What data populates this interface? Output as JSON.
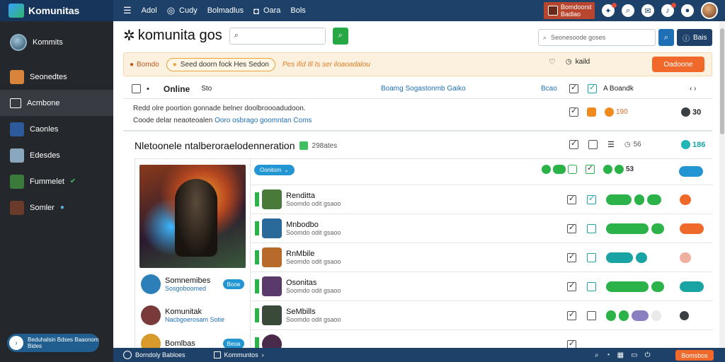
{
  "topbar": {
    "brand": "Komunitas",
    "nav": [
      {
        "icon": "menu-icon",
        "label": ""
      },
      {
        "icon": "",
        "label": "Adol"
      },
      {
        "icon": "globe-icon",
        "label": "Cudy"
      },
      {
        "icon": "",
        "label": "Bolmadlus"
      },
      {
        "icon": "shield-icon",
        "label": "Oara"
      },
      {
        "icon": "",
        "label": "Bols"
      }
    ],
    "promo": "Bomdoorst Badlao",
    "icons": [
      "gamepad-icon",
      "search-icon",
      "mail-icon",
      "bell-icon",
      "chat-icon"
    ]
  },
  "sidebar": {
    "items": [
      {
        "label": "Kommits",
        "kind": "avatar"
      },
      {
        "label": "Seonedtes",
        "kind": "thumb",
        "color": "#d8843a"
      },
      {
        "label": "Acmbone",
        "kind": "icon",
        "active": true
      },
      {
        "label": "Caonles",
        "kind": "thumb",
        "color": "#2c5a9a"
      },
      {
        "label": "Edesdes",
        "kind": "thumb",
        "color": "#8aa7c0"
      },
      {
        "label": "Fummelet",
        "kind": "thumb",
        "color": "#3a7a3a",
        "badge": "✔"
      },
      {
        "label": "Somler",
        "kind": "thumb",
        "color": "#6a3a2a",
        "badge": "●"
      }
    ],
    "footer": "Beduhalsin Bdses Baaonom Bides"
  },
  "main": {
    "title": "komunita gos",
    "search_placeholder": "",
    "right_search_placeholder": "Seonesoode goses",
    "right_button": "Bais",
    "banner": {
      "tag": "Bomdo",
      "pill": "Seed doorn fock Hes Sedon",
      "text": "Pes ifid Ill Is ser iloaoadalou",
      "dropdown": "kaild",
      "button": "Oadoone"
    },
    "list_header": {
      "title": "Online",
      "sub": "Sto",
      "link": "Boamg Sogastonmb Gaiko",
      "col1": "Bcao",
      "col4": "A Boandk"
    },
    "desc": {
      "line1": "Redd olre poortion gonnade belner doolbroooadudoon.",
      "line2_prefix": "Coode delar neaoteoalen",
      "line2_link": "Ooro osbrago goomntan Coms",
      "count1": "190",
      "count2": "30"
    },
    "section": {
      "title": "Nletoonele ntalberoraelodenneration",
      "count": "298ates",
      "grey_count": "56",
      "teal_count": "186"
    },
    "sub_header": {
      "pill": "Oonitom",
      "count": "53"
    },
    "left_users": [
      {
        "name": "Somnemibes",
        "sub": "Sosgoboomed",
        "pill": "Bone",
        "color": "#2c7fb8"
      },
      {
        "name": "Komunitak",
        "sub": "Nacbgoerosam Sotie",
        "pill": "",
        "color": "#7a3a3a"
      },
      {
        "name": "Bomlbas",
        "sub": "",
        "pill": "Beoa",
        "color": "#d89a2a"
      }
    ],
    "rows": [
      {
        "name": "Renditta",
        "sub": "Soomdo odit gsaoo",
        "color": "#4a7a3a",
        "pills": [
          "green:100",
          "green:",
          "green:"
        ],
        "end": "orange:"
      },
      {
        "name": "Mnbodbo",
        "sub": "Soomdo odit gsaoo",
        "color": "#2a6a9a",
        "pills": [
          "green:ooo 600",
          "green:"
        ],
        "end": "orange:Dooo"
      },
      {
        "name": "RnMbile",
        "sub": "Seomdo odit gsaoo",
        "color": "#b86a2a",
        "pills": [
          "teal:o",
          "teal:"
        ],
        "end": "grey:"
      },
      {
        "name": "Osonitas",
        "sub": "Soomdo odit gsaoo",
        "color": "#5a3a6a",
        "pills": [
          "green:ooo 600",
          "green:"
        ],
        "end": "teal:"
      },
      {
        "name": "SeMbills",
        "sub": "Soomdo odit gsaoo",
        "color": "#3a4a3a",
        "pills": [
          "green:",
          "green:",
          "purple:",
          "grey:"
        ],
        "end": "dark:30"
      }
    ]
  },
  "statusbar": {
    "left": "Borndoly Babloes",
    "middle": "Kommuntos",
    "button": "Bomsbos"
  }
}
